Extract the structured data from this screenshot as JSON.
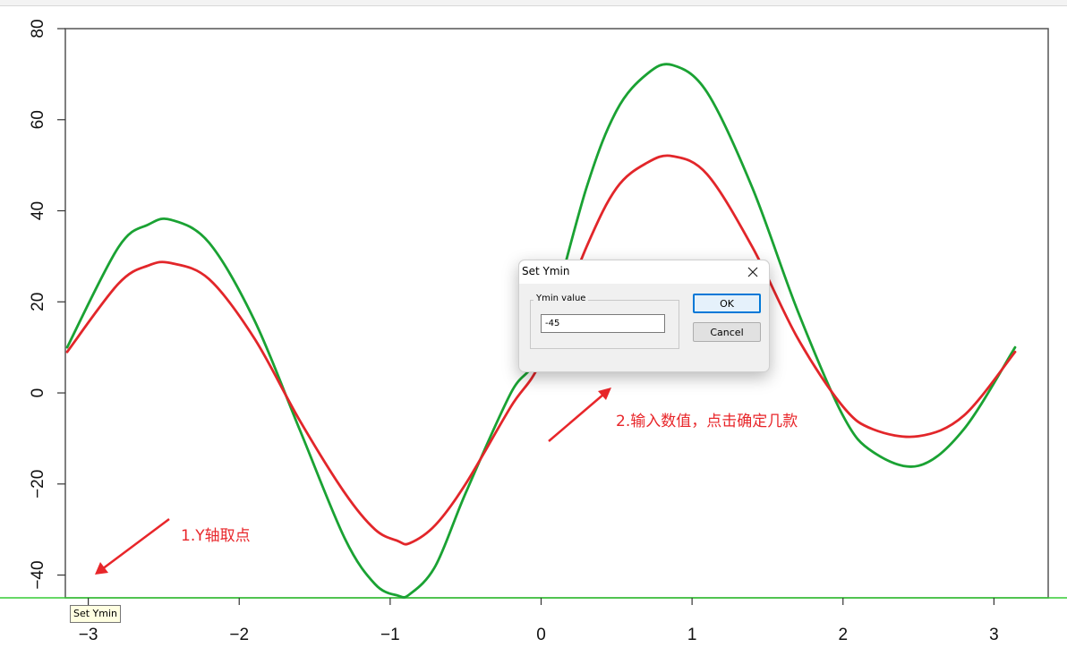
{
  "tooltip": {
    "text": "Set Ymin"
  },
  "annotations": {
    "step1": "1.Y轴取点",
    "step2": "2.输入数值，点击确定几款"
  },
  "dialog": {
    "title": "Set Ymin",
    "group_label": "Ymin value",
    "input_value": "-45",
    "ok_label": "OK",
    "cancel_label": "Cancel",
    "close_icon": "close-icon"
  },
  "colors": {
    "red_curve": "#e2262a",
    "green_curve": "#1aa233",
    "marker_line": "#33cc33",
    "annotation": "#e8262a",
    "ok_focus": "#0078d7"
  },
  "chart_data": {
    "type": "line",
    "xlim": [
      -3.14,
      3.14
    ],
    "ylim": [
      -45,
      80
    ],
    "x_ticks": [
      -3,
      -2,
      -1,
      0,
      1,
      2,
      3
    ],
    "y_ticks": [
      -40,
      -20,
      0,
      20,
      40,
      60,
      80
    ],
    "x_tick_labels": [
      "−3",
      "−2",
      "−1",
      "0",
      "1",
      "2",
      "3"
    ],
    "y_tick_labels": [
      "−40",
      "−20",
      "0",
      "20",
      "40",
      "60",
      "80"
    ],
    "grid": false,
    "ymin_marker": -45,
    "series": [
      {
        "color": "#1aa233",
        "x": [
          -3.14,
          -2.8,
          -2.6,
          -2.45,
          -2.2,
          -1.9,
          -1.6,
          -1.3,
          -1.1,
          -0.95,
          -0.87,
          -0.7,
          -0.5,
          -0.2,
          0.0,
          0.3,
          0.5,
          0.7,
          0.87,
          1.1,
          1.4,
          1.7,
          2.0,
          2.2,
          2.5,
          2.8,
          3.14
        ],
        "y": [
          10,
          32,
          37,
          38,
          33,
          16,
          -8,
          -32,
          -42,
          -44.5,
          -44.2,
          -38,
          -22,
          0,
          10,
          45,
          62,
          70,
          72,
          66,
          45,
          18,
          -5,
          -13,
          -16,
          -8,
          10
        ]
      },
      {
        "color": "#e2262a",
        "x": [
          -3.14,
          -2.8,
          -2.6,
          -2.45,
          -2.2,
          -1.9,
          -1.6,
          -1.3,
          -1.1,
          -0.95,
          -0.87,
          -0.7,
          -0.5,
          -0.2,
          0.0,
          0.3,
          0.5,
          0.7,
          0.87,
          1.1,
          1.4,
          1.7,
          2.0,
          2.2,
          2.5,
          2.8,
          3.14
        ],
        "y": [
          9,
          24,
          28,
          28.5,
          25,
          12,
          -6,
          -22,
          -30,
          -32.5,
          -33,
          -29,
          -20,
          -3,
          7,
          32,
          45,
          50.5,
          52,
          48,
          32,
          12,
          -3,
          -8,
          -9.5,
          -5,
          9
        ]
      }
    ]
  }
}
